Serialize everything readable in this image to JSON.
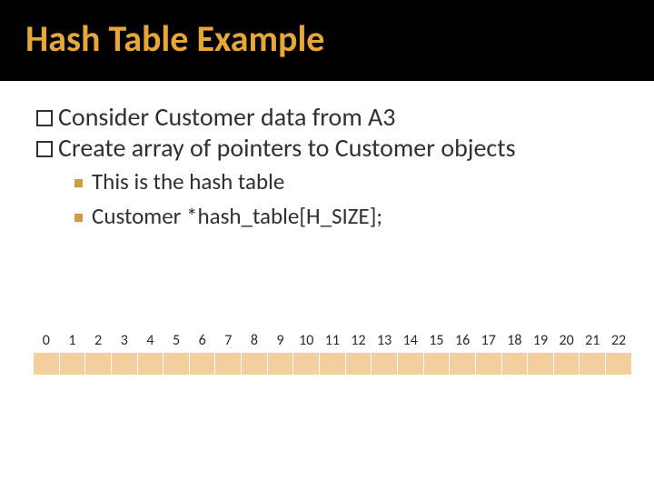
{
  "title": "Hash Table Example",
  "bullets": {
    "l1": [
      "Consider Customer data from A3",
      "Create array of pointers to Customer objects"
    ],
    "l2": [
      "This is the hash table",
      "Customer *hash_table[H_SIZE];"
    ]
  },
  "array": {
    "indices": [
      "0",
      "1",
      "2",
      "3",
      "4",
      "5",
      "6",
      "7",
      "8",
      "9",
      "10",
      "11",
      "12",
      "13",
      "14",
      "15",
      "16",
      "17",
      "18",
      "19",
      "20",
      "21",
      "22"
    ]
  }
}
